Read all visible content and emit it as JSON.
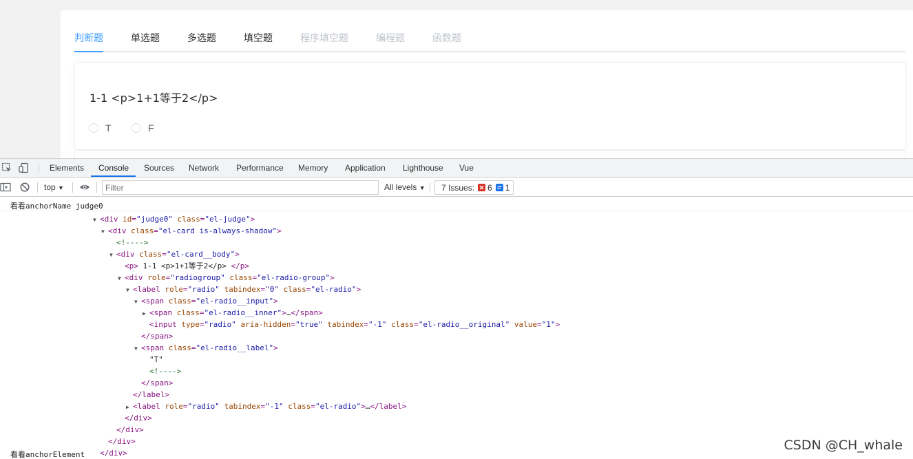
{
  "page": {
    "tabs": [
      {
        "label": "判断题",
        "state": "active"
      },
      {
        "label": "单选题",
        "state": "normal"
      },
      {
        "label": "多选题",
        "state": "normal"
      },
      {
        "label": "填空题",
        "state": "normal"
      },
      {
        "label": "程序填空题",
        "state": "disabled"
      },
      {
        "label": "编程题",
        "state": "disabled"
      },
      {
        "label": "函数题",
        "state": "disabled"
      }
    ],
    "question": {
      "text": "1-1 <p>1+1等于2</p>",
      "options": [
        "T",
        "F"
      ]
    },
    "colors": {
      "accent": "#409eff",
      "disabled": "#c0c4cc"
    }
  },
  "devtools": {
    "tabs": [
      "Elements",
      "Console",
      "Sources",
      "Network",
      "Performance",
      "Memory",
      "Application",
      "Lighthouse",
      "Vue"
    ],
    "active_tab": "Console",
    "toolbar": {
      "context": "top",
      "filter_placeholder": "Filter",
      "levels": "All levels",
      "issues_label": "7 Issues:",
      "errors_count": "6",
      "info_count": "1"
    },
    "console": {
      "log1": {
        "label": "看看",
        "text": "anchorName judge0"
      },
      "log2": {
        "label": "看看",
        "text": "anchorElement"
      },
      "tree": [
        {
          "indent": 0,
          "tri": "▼",
          "html": "<span class=\"t-tag\">&lt;div </span><span class=\"t-attr\">id</span><span class=\"t-tag\">=</span><span class=\"t-val\">\"judge0\"</span><span class=\"t-tag\"> </span><span class=\"t-attr\">class</span><span class=\"t-tag\">=</span><span class=\"t-val\">\"el-judge\"</span><span class=\"t-tag\">&gt;</span>"
        },
        {
          "indent": 1,
          "tri": "▼",
          "html": "<span class=\"t-tag\">&lt;div </span><span class=\"t-attr\">class</span><span class=\"t-tag\">=</span><span class=\"t-val\">\"el-card is-always-shadow\"</span><span class=\"t-tag\">&gt;</span>"
        },
        {
          "indent": 2,
          "tri": "",
          "html": "<span class=\"t-cmt\">&lt;!----&gt;</span>"
        },
        {
          "indent": 2,
          "tri": "▼",
          "html": "<span class=\"t-tag\">&lt;div </span><span class=\"t-attr\">class</span><span class=\"t-tag\">=</span><span class=\"t-val\">\"el-card__body\"</span><span class=\"t-tag\">&gt;</span>"
        },
        {
          "indent": 3,
          "tri": "",
          "html": "<span class=\"t-tag\">&lt;p&gt;</span><span class=\"t-txt\"> 1-1 &lt;p&gt;1+1等于2&lt;/p&gt; </span><span class=\"t-tag\">&lt;/p&gt;</span>"
        },
        {
          "indent": 3,
          "tri": "▼",
          "html": "<span class=\"t-tag\">&lt;div </span><span class=\"t-attr\">role</span><span class=\"t-tag\">=</span><span class=\"t-val\">\"radiogroup\"</span><span class=\"t-tag\"> </span><span class=\"t-attr\">class</span><span class=\"t-tag\">=</span><span class=\"t-val\">\"el-radio-group\"</span><span class=\"t-tag\">&gt;</span>"
        },
        {
          "indent": 4,
          "tri": "▼",
          "html": "<span class=\"t-tag\">&lt;label </span><span class=\"t-attr\">role</span><span class=\"t-tag\">=</span><span class=\"t-val\">\"radio\"</span><span class=\"t-tag\"> </span><span class=\"t-attr\">tabindex</span><span class=\"t-tag\">=</span><span class=\"t-val\">\"0\"</span><span class=\"t-tag\"> </span><span class=\"t-attr\">class</span><span class=\"t-tag\">=</span><span class=\"t-val\">\"el-radio\"</span><span class=\"t-tag\">&gt;</span>"
        },
        {
          "indent": 5,
          "tri": "▼",
          "html": "<span class=\"t-tag\">&lt;span </span><span class=\"t-attr\">class</span><span class=\"t-tag\">=</span><span class=\"t-val\">\"el-radio__input\"</span><span class=\"t-tag\">&gt;</span>"
        },
        {
          "indent": 6,
          "tri": "▶",
          "html": "<span class=\"t-tag\">&lt;span </span><span class=\"t-attr\">class</span><span class=\"t-tag\">=</span><span class=\"t-val\">\"el-radio__inner\"</span><span class=\"t-tag\">&gt;</span><span class=\"t-txt\">…</span><span class=\"t-tag\">&lt;/span&gt;</span>"
        },
        {
          "indent": 6,
          "tri": "",
          "html": "<span class=\"t-tag\">&lt;input </span><span class=\"t-attr\">type</span><span class=\"t-tag\">=</span><span class=\"t-val\">\"radio\"</span><span class=\"t-tag\"> </span><span class=\"t-attr\">aria-hidden</span><span class=\"t-tag\">=</span><span class=\"t-val\">\"true\"</span><span class=\"t-tag\"> </span><span class=\"t-attr\">tabindex</span><span class=\"t-tag\">=</span><span class=\"t-val\">\"-1\"</span><span class=\"t-tag\"> </span><span class=\"t-attr\">class</span><span class=\"t-tag\">=</span><span class=\"t-val\">\"el-radio__original\"</span><span class=\"t-tag\"> </span><span class=\"t-attr\">value</span><span class=\"t-tag\">=</span><span class=\"t-val\">\"1\"</span><span class=\"t-tag\">&gt;</span>"
        },
        {
          "indent": 5,
          "tri": "",
          "html": "<span class=\"t-tag\">&lt;/span&gt;</span>"
        },
        {
          "indent": 5,
          "tri": "▼",
          "html": "<span class=\"t-tag\">&lt;span </span><span class=\"t-attr\">class</span><span class=\"t-tag\">=</span><span class=\"t-val\">\"el-radio__label\"</span><span class=\"t-tag\">&gt;</span>"
        },
        {
          "indent": 6,
          "tri": "",
          "html": "<span class=\"t-txt\">\"T\"</span>"
        },
        {
          "indent": 6,
          "tri": "",
          "html": "<span class=\"t-cmt\">&lt;!----&gt;</span>"
        },
        {
          "indent": 5,
          "tri": "",
          "html": "<span class=\"t-tag\">&lt;/span&gt;</span>"
        },
        {
          "indent": 4,
          "tri": "",
          "html": "<span class=\"t-tag\">&lt;/label&gt;</span>"
        },
        {
          "indent": 4,
          "tri": "▶",
          "html": "<span class=\"t-tag\">&lt;label </span><span class=\"t-attr\">role</span><span class=\"t-tag\">=</span><span class=\"t-val\">\"radio\"</span><span class=\"t-tag\"> </span><span class=\"t-attr\">tabindex</span><span class=\"t-tag\">=</span><span class=\"t-val\">\"-1\"</span><span class=\"t-tag\"> </span><span class=\"t-attr\">class</span><span class=\"t-tag\">=</span><span class=\"t-val\">\"el-radio\"</span><span class=\"t-tag\">&gt;</span><span class=\"t-txt\">…</span><span class=\"t-tag\">&lt;/label&gt;</span>"
        },
        {
          "indent": 3,
          "tri": "",
          "html": "<span class=\"t-tag\">&lt;/div&gt;</span>"
        },
        {
          "indent": 2,
          "tri": "",
          "html": "<span class=\"t-tag\">&lt;/div&gt;</span>"
        },
        {
          "indent": 1,
          "tri": "",
          "html": "<span class=\"t-tag\">&lt;/div&gt;</span>"
        },
        {
          "indent": 0,
          "tri": "",
          "html": "<span class=\"t-tag\">&lt;/div&gt;</span>"
        }
      ]
    }
  },
  "watermark": "CSDN @CH_whale"
}
